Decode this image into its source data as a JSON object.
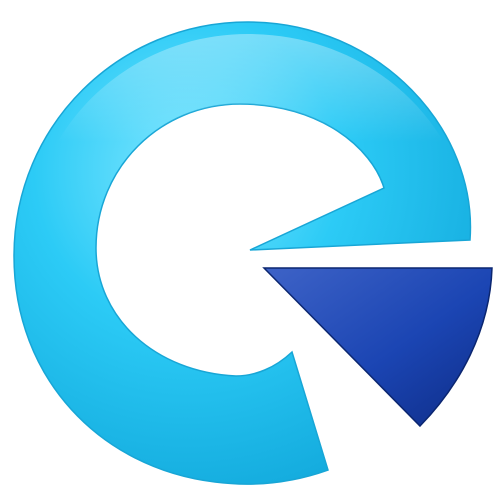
{
  "logo": {
    "icon": "stylized-e-logo-icon",
    "colors": {
      "ring_light": "#7EE6FF",
      "ring_main": "#2CCBF6",
      "ring_dark": "#12A9DC",
      "wedge_light": "#3E63C7",
      "wedge_main": "#1B45B3",
      "wedge_dark": "#0E2C86",
      "background": "#FFFFFF"
    }
  }
}
